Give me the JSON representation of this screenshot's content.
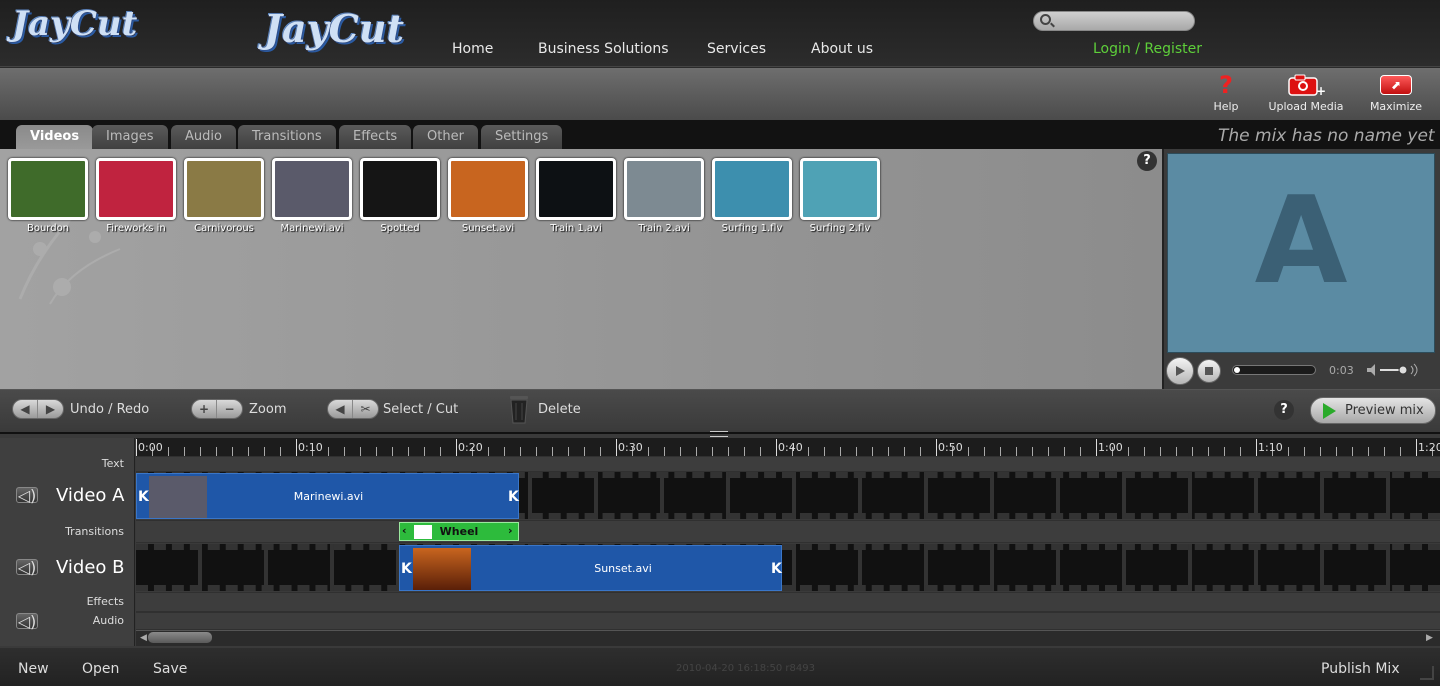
{
  "topnav": {
    "logo": "JayCut",
    "links": [
      "Home",
      "Business Solutions",
      "Services",
      "About us"
    ],
    "search_placeholder": "",
    "login": "Login / Register"
  },
  "appbar": {
    "logo": "JayCut",
    "tools": [
      {
        "label": "Help",
        "icon": "help-icon"
      },
      {
        "label": "Upload Media",
        "icon": "camera-icon"
      },
      {
        "label": "Maximize",
        "icon": "maximize-icon"
      }
    ]
  },
  "tabs": [
    "Videos",
    "Images",
    "Audio",
    "Transitions",
    "Effects",
    "Other",
    "Settings"
  ],
  "active_tab": "Videos",
  "mix_name": "The mix has no name yet",
  "media": [
    {
      "label": "Bourdon",
      "color": "#3f6b2a"
    },
    {
      "label": "Fireworks in",
      "color": "#c0233f"
    },
    {
      "label": "Carnivorous",
      "color": "#8a7a45"
    },
    {
      "label": "Marinewi.avi",
      "color": "#5a5a6a"
    },
    {
      "label": "Spotted",
      "color": "#151515"
    },
    {
      "label": "Sunset.avi",
      "color": "#c8651f"
    },
    {
      "label": "Train 1.avi",
      "color": "#0d1114"
    },
    {
      "label": "Train 2.avi",
      "color": "#7d8a92"
    },
    {
      "label": "Surfing 1.flv",
      "color": "#3d8fae"
    },
    {
      "label": "Surfing 2.flv",
      "color": "#4fa2b5"
    }
  ],
  "preview": {
    "letter": "A",
    "time": "0:03",
    "screen_color": "#5b8ba3"
  },
  "toolbar": {
    "undo_redo": "Undo / Redo",
    "zoom": "Zoom",
    "select_cut": "Select / Cut",
    "delete": "Delete",
    "preview_mix": "Preview mix"
  },
  "timeline": {
    "ruler": [
      "0:00",
      "0:10",
      "0:20",
      "0:30",
      "0:40",
      "0:50",
      "1:00",
      "1:10",
      "1:20"
    ],
    "tracks": {
      "text": "Text",
      "video_a": "Video A",
      "transitions": "Transitions",
      "video_b": "Video B",
      "effects": "Effects",
      "audio": "Audio"
    },
    "clips": {
      "video_a": "Marinewi.avi",
      "transition": "Wheel",
      "video_b": "Sunset.avi"
    }
  },
  "bottom": {
    "new": "New",
    "open": "Open",
    "save": "Save",
    "version": "2010-04-20 16:18:50 r8493",
    "publish": "Publish Mix"
  }
}
